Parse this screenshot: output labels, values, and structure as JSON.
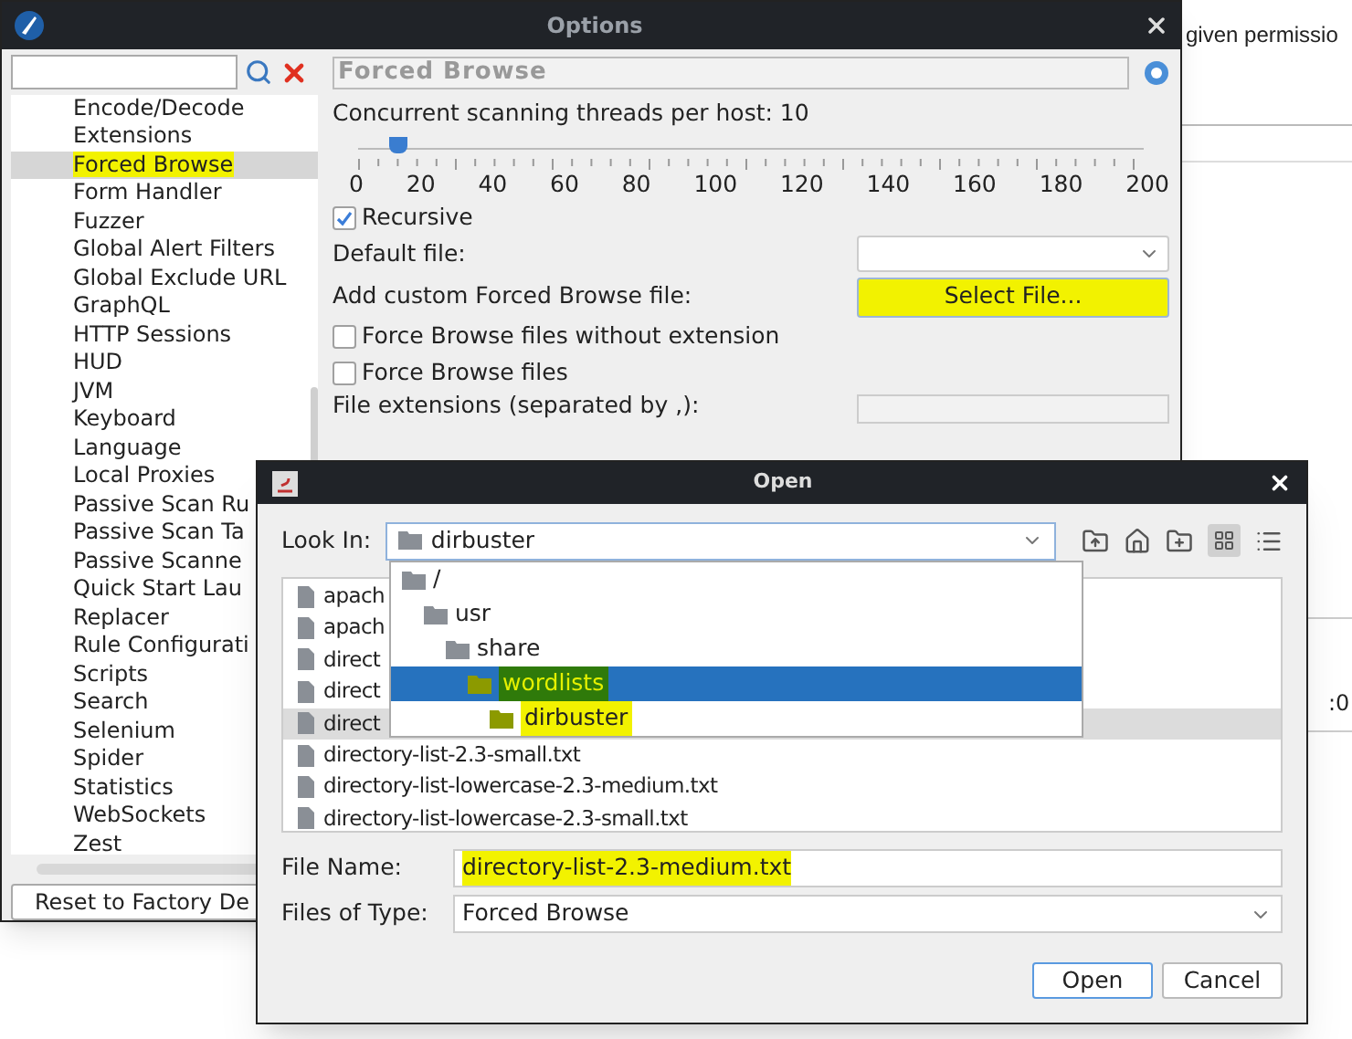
{
  "background_page": {
    "text": "given permissio",
    "cell_text": ":0"
  },
  "options_window": {
    "title": "Options",
    "tree": [
      {
        "label": "Encode/Decode",
        "selected": false,
        "highlighted": false
      },
      {
        "label": "Extensions",
        "selected": false,
        "highlighted": false
      },
      {
        "label": "Forced Browse",
        "selected": true,
        "highlighted": true
      },
      {
        "label": "Form Handler",
        "selected": false,
        "highlighted": false
      },
      {
        "label": "Fuzzer",
        "selected": false,
        "highlighted": false
      },
      {
        "label": "Global Alert Filters",
        "selected": false,
        "highlighted": false
      },
      {
        "label": "Global Exclude URL",
        "selected": false,
        "highlighted": false
      },
      {
        "label": "GraphQL",
        "selected": false,
        "highlighted": false
      },
      {
        "label": "HTTP Sessions",
        "selected": false,
        "highlighted": false
      },
      {
        "label": "HUD",
        "selected": false,
        "highlighted": false
      },
      {
        "label": "JVM",
        "selected": false,
        "highlighted": false
      },
      {
        "label": "Keyboard",
        "selected": false,
        "highlighted": false
      },
      {
        "label": "Language",
        "selected": false,
        "highlighted": false
      },
      {
        "label": "Local Proxies",
        "selected": false,
        "highlighted": false
      },
      {
        "label": "Passive Scan Ru",
        "selected": false,
        "highlighted": false
      },
      {
        "label": "Passive Scan Ta",
        "selected": false,
        "highlighted": false
      },
      {
        "label": "Passive Scanne",
        "selected": false,
        "highlighted": false
      },
      {
        "label": "Quick Start Lau",
        "selected": false,
        "highlighted": false
      },
      {
        "label": "Replacer",
        "selected": false,
        "highlighted": false
      },
      {
        "label": "Rule Configurati",
        "selected": false,
        "highlighted": false
      },
      {
        "label": "Scripts",
        "selected": false,
        "highlighted": false
      },
      {
        "label": "Search",
        "selected": false,
        "highlighted": false
      },
      {
        "label": "Selenium",
        "selected": false,
        "highlighted": false
      },
      {
        "label": "Spider",
        "selected": false,
        "highlighted": false
      },
      {
        "label": "Statistics",
        "selected": false,
        "highlighted": false
      },
      {
        "label": "WebSockets",
        "selected": false,
        "highlighted": false
      },
      {
        "label": "Zest",
        "selected": false,
        "highlighted": false
      }
    ],
    "reset_button": "Reset to Factory De",
    "panel": {
      "title": "Forced Browse",
      "threads_label": "Concurrent scanning threads per host: 10",
      "slider": {
        "level": 0.05,
        "ticks": [
          "0",
          "20",
          "40",
          "60",
          "80",
          "100",
          "120",
          "140",
          "160",
          "180",
          "200"
        ]
      },
      "recursive": {
        "label": "Recursive",
        "checked": true
      },
      "default_file_label": "Default file:",
      "custom_file_label": "Add custom Forced Browse file:",
      "select_button": {
        "label": "Select File...",
        "highlighted": true
      },
      "options": [
        {
          "label": "Force Browse files without extension",
          "checked": false
        },
        {
          "label": "Force Browse files",
          "checked": false
        }
      ],
      "extensions_label": "File extensions (separated by ,):"
    }
  },
  "open_dialog": {
    "title": "Open",
    "look_in_label": "Look In:",
    "look_in_value": "dirbuster",
    "path_popup": [
      {
        "label": "/",
        "selected": false,
        "highlighted": false,
        "children": [
          {
            "label": "usr",
            "selected": false,
            "highlighted": false,
            "children": [
              {
                "label": "share",
                "selected": false,
                "highlighted": false,
                "children": [
                  {
                    "label": "wordlists",
                    "selected": true,
                    "highlighted": true,
                    "children": [
                      {
                        "label": "dirbuster",
                        "selected": false,
                        "highlighted": true
                      }
                    ]
                  }
                ]
              }
            ]
          }
        ]
      }
    ],
    "files": [
      {
        "name": "apach",
        "selected": false
      },
      {
        "name": "apach",
        "selected": false
      },
      {
        "name": "direct",
        "selected": false
      },
      {
        "name": "direct",
        "selected": false
      },
      {
        "name": "direct",
        "selected": true
      },
      {
        "name": "directory-list-2.3-small.txt",
        "selected": false
      },
      {
        "name": "directory-list-lowercase-2.3-medium.txt",
        "selected": false
      },
      {
        "name": "directory-list-lowercase-2.3-small.txt",
        "selected": false
      }
    ],
    "file_name_label": "File Name:",
    "file_name_value": "directory-list-2.3-medium.txt",
    "file_name_highlighted": true,
    "file_type_label": "Files of Type:",
    "file_type_value": "Forced Browse",
    "buttons": [
      "Open",
      "Cancel"
    ]
  }
}
